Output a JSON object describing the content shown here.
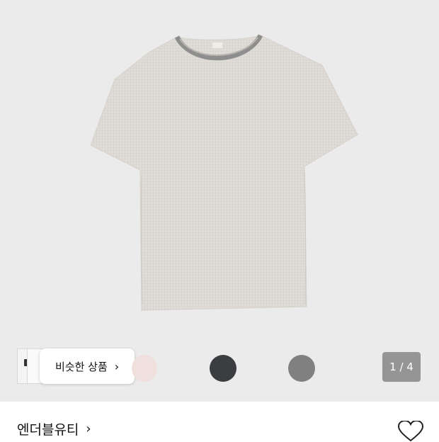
{
  "product": {
    "image_alt": "heather beige short sleeve t-shirt",
    "brand": "엔더블유티",
    "similar_label": "비슷한 상품",
    "page_indicator": "1 / 4"
  },
  "colors": {
    "background": "#ebebeb",
    "swatches": [
      "#efe0dd",
      "#3b3d41",
      "#808080"
    ]
  },
  "icons": {
    "similar_chevron": "›",
    "brand_chevron": "›",
    "wishlist": "heart-outline-icon"
  }
}
